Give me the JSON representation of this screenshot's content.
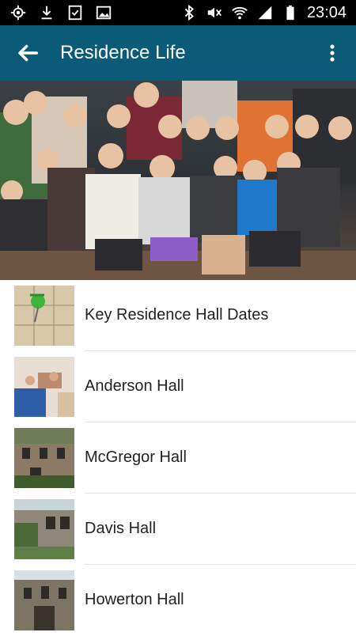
{
  "status_bar": {
    "time": "23:04",
    "icons": [
      "location-icon",
      "download-icon",
      "checklist-icon",
      "image-icon",
      "bluetooth-icon",
      "mute-icon",
      "wifi-icon",
      "signal-icon",
      "battery-icon"
    ]
  },
  "app_bar": {
    "title": "Residence Life",
    "background": "#0a5a78",
    "back_icon": "arrow-back-icon",
    "menu_icon": "more-vert-icon"
  },
  "hero": {
    "image": "group-photo-students"
  },
  "list": {
    "items": [
      {
        "label": "Key Residence Hall Dates",
        "thumb": "calendar-pin-photo"
      },
      {
        "label": "Anderson Hall",
        "thumb": "lounge-photo"
      },
      {
        "label": "McGregor Hall",
        "thumb": "stone-building-photo"
      },
      {
        "label": "Davis Hall",
        "thumb": "stone-building-photo-2"
      },
      {
        "label": "Howerton Hall",
        "thumb": "stone-building-photo-3"
      }
    ]
  }
}
